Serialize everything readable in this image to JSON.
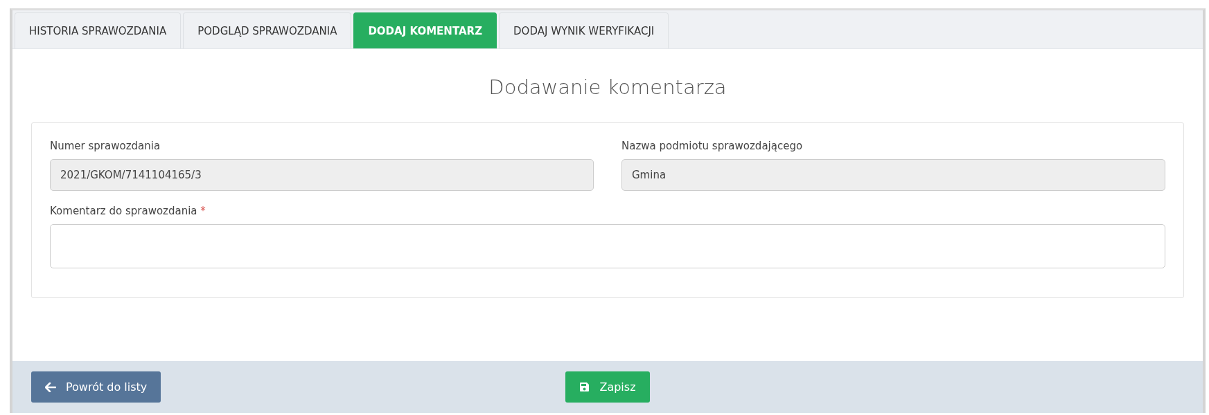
{
  "tabs": [
    {
      "label": "HISTORIA SPRAWOZDANIA",
      "selected": false
    },
    {
      "label": "PODGLĄD SPRAWOZDANIA",
      "selected": false
    },
    {
      "label": "DODAJ KOMENTARZ",
      "selected": true
    },
    {
      "label": "DODAJ WYNIK WERYFIKACJI",
      "selected": false
    }
  ],
  "title": "Dodawanie komentarza",
  "fields": [
    {
      "label": "Numer sprawozdania",
      "value": "2021/GKOM/7141104165/3",
      "disabled": true
    },
    {
      "label": "Nazwa podmiotu sprawozdającego",
      "value": "Gmina",
      "disabled": true
    }
  ],
  "comment": {
    "label": "Komentarz do sprawozdania",
    "required_mark": "*"
  },
  "buttons": {
    "back": "Powrót do listy",
    "save": "Zapisz"
  }
}
